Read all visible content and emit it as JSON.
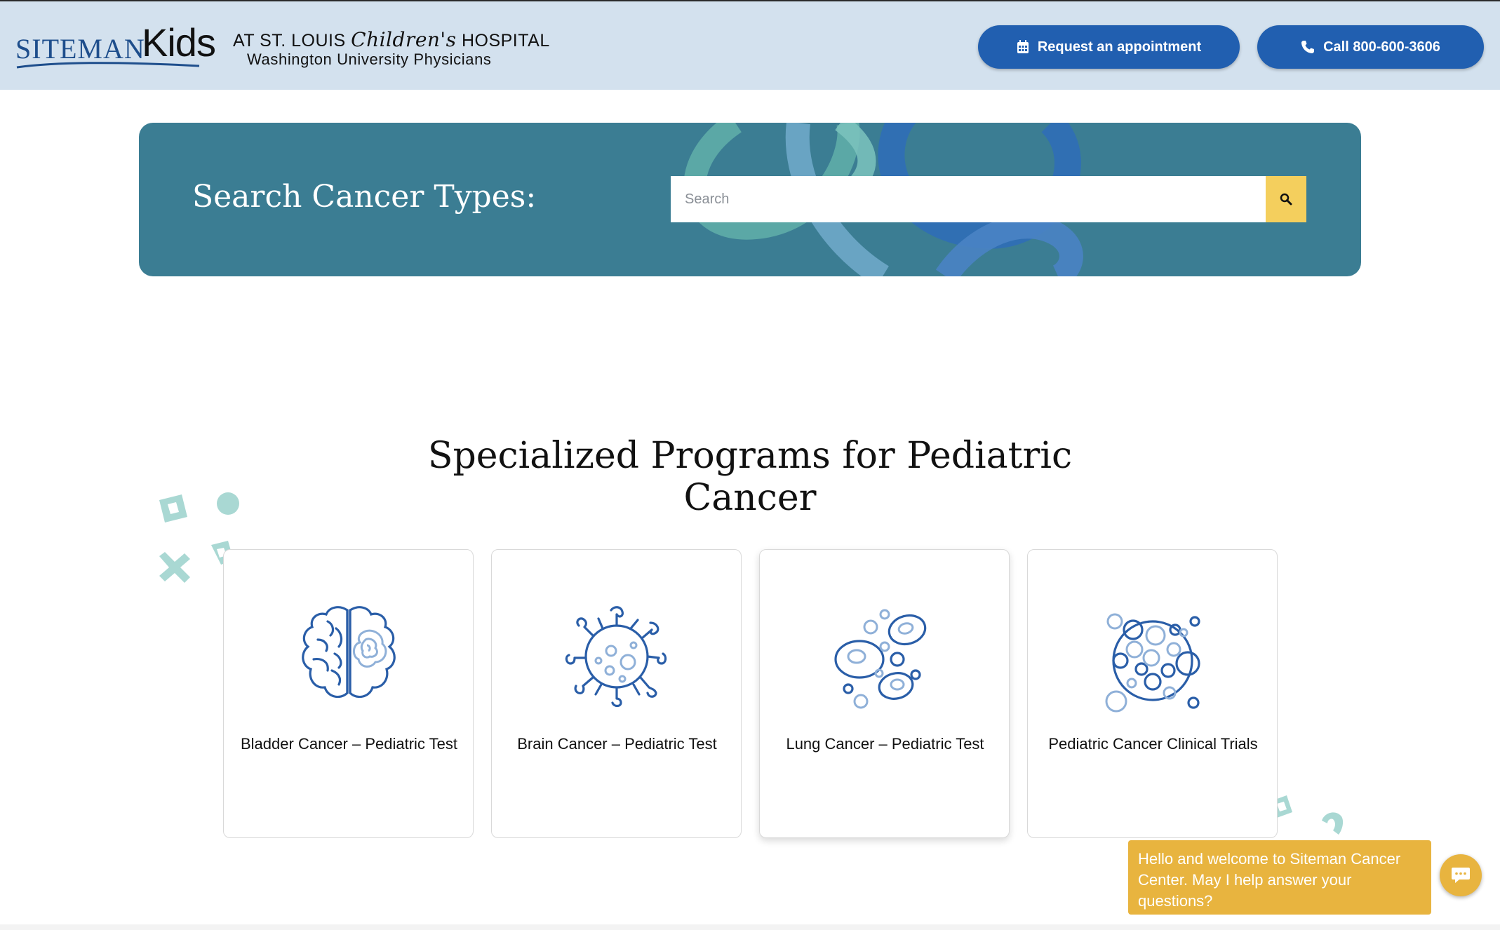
{
  "header": {
    "logo": {
      "brand": "SITEMAN",
      "brand_kids": "Kids",
      "line1_prefix": "AT ST. LOUIS",
      "line1_script": "Children's",
      "line1_suffix": "HOSPITAL",
      "line2": "Washington University Physicians"
    },
    "appointment_button": {
      "label": "Request an appointment",
      "icon": "calendar-icon"
    },
    "call_button": {
      "label": "Call 800-600-3606",
      "icon": "phone-icon"
    }
  },
  "search": {
    "title": "Search Cancer Types:",
    "placeholder": "Search",
    "button_icon": "search-icon"
  },
  "programs": {
    "title": "Specialized Programs for Pediatric Cancer",
    "cards": [
      {
        "title": "Bladder Cancer – Pediatric Test",
        "icon": "brain-icon"
      },
      {
        "title": "Brain Cancer – Pediatric Test",
        "icon": "virus-cell-icon"
      },
      {
        "title": "Lung Cancer – Pediatric Test",
        "icon": "cells-icon"
      },
      {
        "title": "Pediatric Cancer Clinical Trials",
        "icon": "cell-cluster-icon"
      }
    ]
  },
  "chat": {
    "message": "Hello and welcome to Siteman Cancer Center. May I help answer your questions?",
    "button_icon": "chat-icon"
  },
  "colors": {
    "header_bg": "#d3e1ee",
    "primary_button": "#215fb0",
    "banner_bg": "#3b7d93",
    "search_button": "#f4cf5d",
    "chat_bg": "#e8b43f",
    "icon_dark": "#2a5ea8",
    "icon_light": "#8fb0d8",
    "decor_teal": "#a9d8d3"
  }
}
